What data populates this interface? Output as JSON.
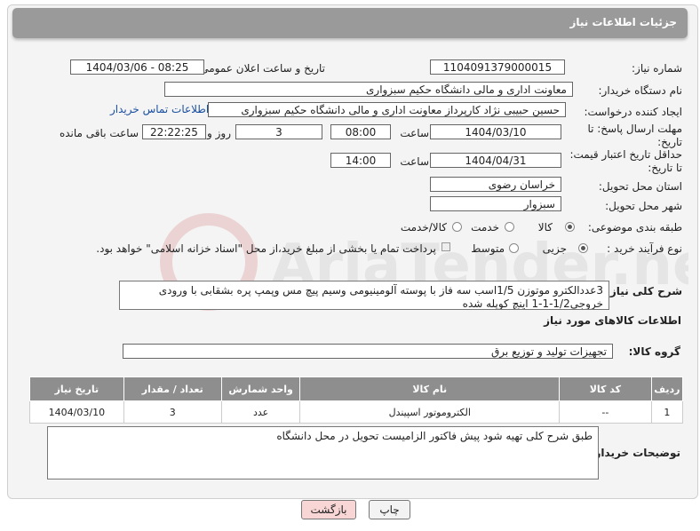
{
  "header": {
    "title": "جزئیات اطلاعات نیاز"
  },
  "fields": {
    "need_number_label": "شماره نیاز:",
    "need_number": "1104091379000015",
    "announce_label": "تاریخ و ساعت اعلان عمومی:",
    "announce_value": "1404/03/06 - 08:25",
    "buyer_org_label": "نام دستگاه خریدار:",
    "buyer_org": "معاونت اداری و مالی دانشگاه حکیم سبزواری",
    "creator_label": "ایجاد کننده درخواست:",
    "creator": "حسین حبیبی نژاد کارپرداز معاونت اداری و مالی دانشگاه حکیم سبزواری",
    "contact_link": "اطلاعات تماس خریدار",
    "deadline_label_1": "مهلت ارسال پاسخ: تا",
    "deadline_label_2": "تاریخ:",
    "deadline_date": "1404/03/10",
    "time_label": "ساعت",
    "deadline_time": "08:00",
    "days_value": "3",
    "days_label": "روز و",
    "remaining_time": "22:22:25",
    "remaining_label": "ساعت باقی مانده",
    "validity_label_1": "حداقل تاریخ اعتبار قیمت:",
    "validity_label_2": "تا تاریخ:",
    "validity_date": "1404/04/31",
    "validity_time": "14:00",
    "province_label": "استان محل تحویل:",
    "province": "خراسان رضوی",
    "city_label": "شهر محل تحویل:",
    "city": "سبزوار",
    "category_label": "طبقه بندی موضوعی:",
    "category_options": [
      "کالا",
      "خدمت",
      "کالا/خدمت"
    ],
    "process_label": "نوع فرآیند خرید :",
    "process_options": [
      "جزیی",
      "متوسط"
    ],
    "payment_note": "پرداخت تمام یا بخشی از مبلغ خرید،از محل \"اسناد خزانه اسلامی\" خواهد بود.",
    "description_label": "شرح کلی نیاز:",
    "description": "3عددالکترو موتوزن 1/5اسب سه فاز با پوسته آلومینیومی وسیم پیچ مس وپمپ پره بشقابی با ورودی خروجی1/2-1-1 اینچ کوپله شده",
    "goods_info_title": "اطلاعات کالاهای مورد نیاز",
    "goods_group_label": "گروه کالا:",
    "goods_group": "تجهیزات تولید و توزیع برق"
  },
  "table": {
    "headers": [
      "ردیف",
      "کد کالا",
      "نام کالا",
      "واحد شمارش",
      "تعداد / مقدار",
      "تاریخ نیاز"
    ],
    "rows": [
      [
        "1",
        "--",
        "الکتروموتور اسپیندل",
        "عدد",
        "3",
        "1404/03/10"
      ]
    ]
  },
  "buyer_notes": {
    "label": "توضیحات خریدار:",
    "text": "طبق شرح کلی تهیه شود پیش فاکتور الزامیست  تحویل در محل دانشگاه"
  },
  "buttons": {
    "print": "چاپ",
    "back": "بازگشت"
  },
  "watermark": {
    "text": "AriaTender.net"
  },
  "colors": {
    "header_bg": "#9a9a9a",
    "link": "#1a4fa0",
    "back_button_bg": "#f9d6d6"
  }
}
